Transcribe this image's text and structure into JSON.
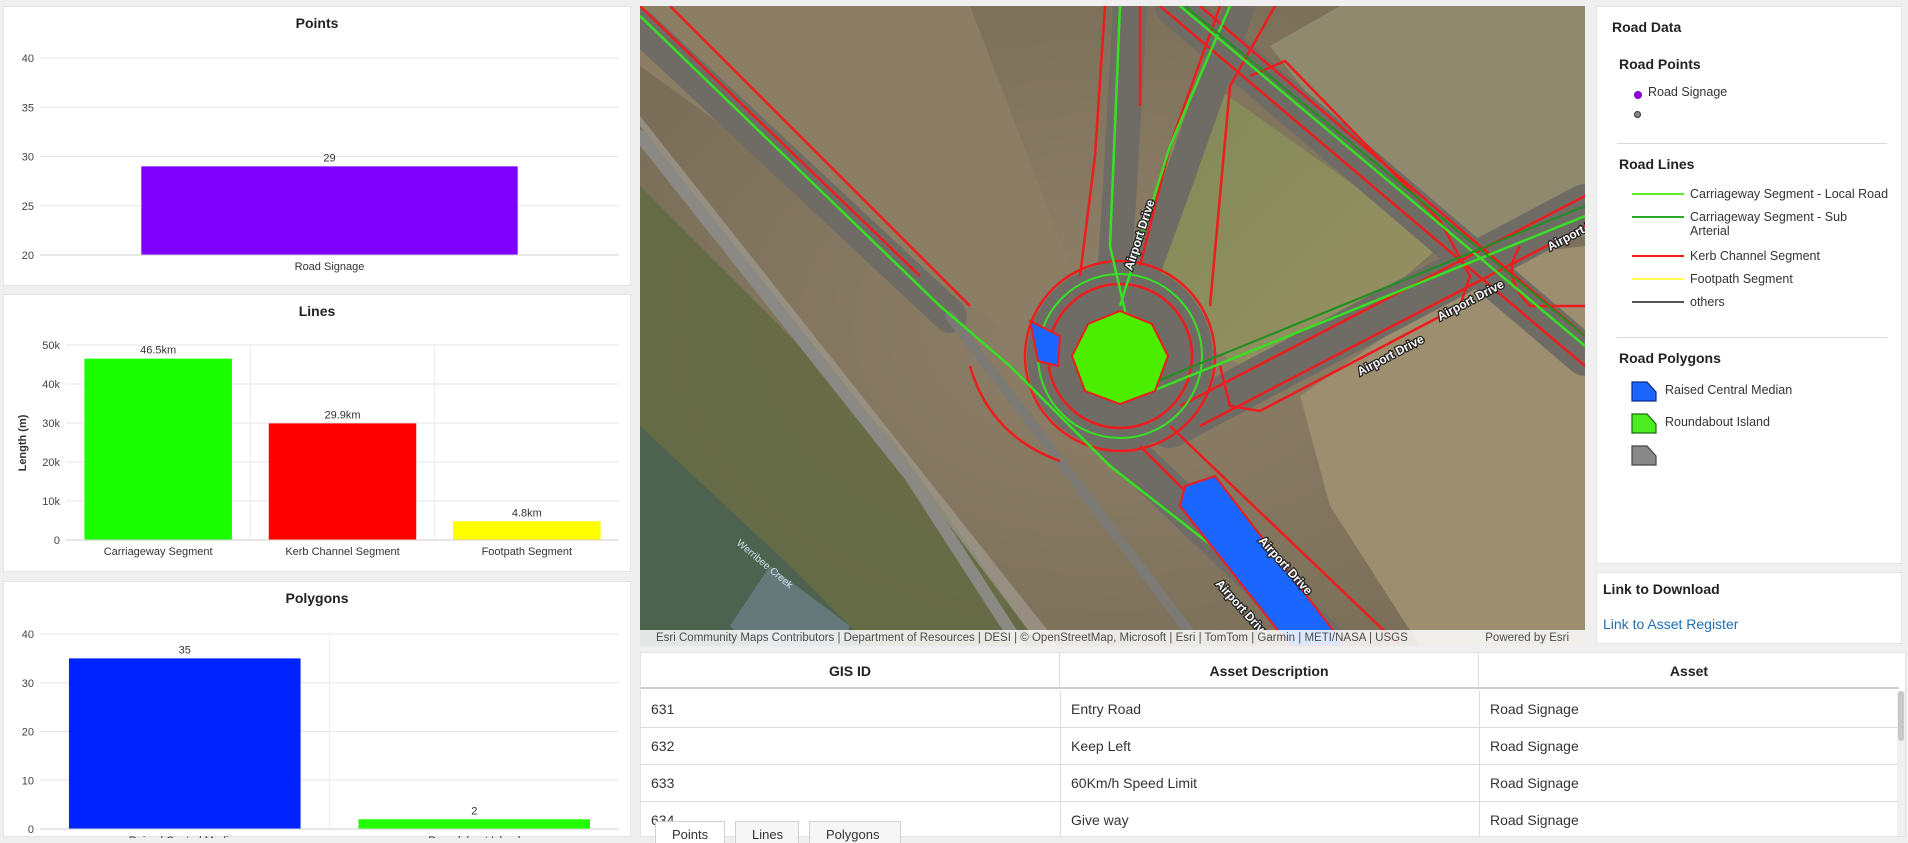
{
  "points_chart": {
    "title": "Points",
    "chart_data": {
      "type": "bar",
      "categories": [
        "Road Signage"
      ],
      "values": [
        29
      ],
      "data_labels": [
        "29"
      ],
      "ylim": [
        20,
        40
      ],
      "yticks": [
        20,
        25,
        30,
        35,
        40
      ],
      "colors": [
        "#8000ff"
      ]
    }
  },
  "lines_chart": {
    "title": "Lines",
    "ylabel": "Length (m)",
    "chart_data": {
      "type": "bar",
      "categories": [
        "Carriageway Segment",
        "Kerb Channel Segment",
        "Footpath Segment"
      ],
      "values": [
        46500,
        29900,
        4800
      ],
      "data_labels": [
        "46.5km",
        "29.9km",
        "4.8km"
      ],
      "ylim": [
        0,
        50000
      ],
      "yticks": [
        0,
        10000,
        20000,
        30000,
        40000,
        50000
      ],
      "ytick_labels": [
        "0",
        "10k",
        "20k",
        "30k",
        "40k",
        "50k"
      ],
      "colors": [
        "#1aff00",
        "#ff0000",
        "#ffff00"
      ]
    }
  },
  "polygons_chart": {
    "title": "Polygons",
    "chart_data": {
      "type": "bar",
      "categories": [
        "Raised Central Median",
        "Roundabout Island"
      ],
      "values": [
        35,
        2
      ],
      "data_labels": [
        "35",
        "2"
      ],
      "ylim": [
        0,
        40
      ],
      "yticks": [
        0,
        10,
        20,
        30,
        40
      ],
      "colors": [
        "#0022ff",
        "#22ff00"
      ]
    }
  },
  "map": {
    "road_labels": [
      "Airport Drive",
      "Airport Drive",
      "Airport Drive",
      "Airport Drive",
      "Airport Drive",
      "Airport Drive"
    ],
    "creek_label": "Werribee Creek",
    "attribution": "Esri Community Maps Contributors | Department of Resources | DESI | © OpenStreetMap, Microsoft | Esri | TomTom | Garmin | METI/NASA | USGS",
    "powered_by": "Powered by Esri"
  },
  "legend": {
    "title": "Road Data",
    "points_heading": "Road Points",
    "points": [
      {
        "label": "Road Signage",
        "color": "#8a00d4"
      },
      {
        "label": "",
        "color": "#888888"
      }
    ],
    "lines_heading": "Road Lines",
    "lines": [
      {
        "label": "Carriageway Segment - Local Road",
        "color": "#5aee33"
      },
      {
        "label": "Carriageway Segment - Sub Arterial",
        "color": "#2aa82a"
      },
      {
        "label": "Kerb Channel Segment",
        "color": "#ee2222"
      },
      {
        "label": "Footpath Segment",
        "color": "#ffff55"
      },
      {
        "label": "others",
        "color": "#555555"
      }
    ],
    "polygons_heading": "Road Polygons",
    "polygons": [
      {
        "label": "Raised Central Median",
        "color": "#1a66ff"
      },
      {
        "label": "Roundabout Island",
        "color": "#4cee22"
      },
      {
        "label": "",
        "color": "#888888"
      }
    ]
  },
  "download": {
    "title": "Link to Download",
    "link": "Link to Asset Register"
  },
  "table": {
    "headers": [
      "GIS ID",
      "Asset Description",
      "Asset"
    ],
    "rows": [
      [
        "631",
        "Entry Road",
        "Road Signage"
      ],
      [
        "632",
        "Keep Left",
        "Road Signage"
      ],
      [
        "633",
        "60Km/h Speed Limit",
        "Road Signage"
      ],
      [
        "634",
        "Give way",
        "Road Signage"
      ]
    ],
    "tabs": [
      "Points",
      "Lines",
      "Polygons"
    ]
  }
}
